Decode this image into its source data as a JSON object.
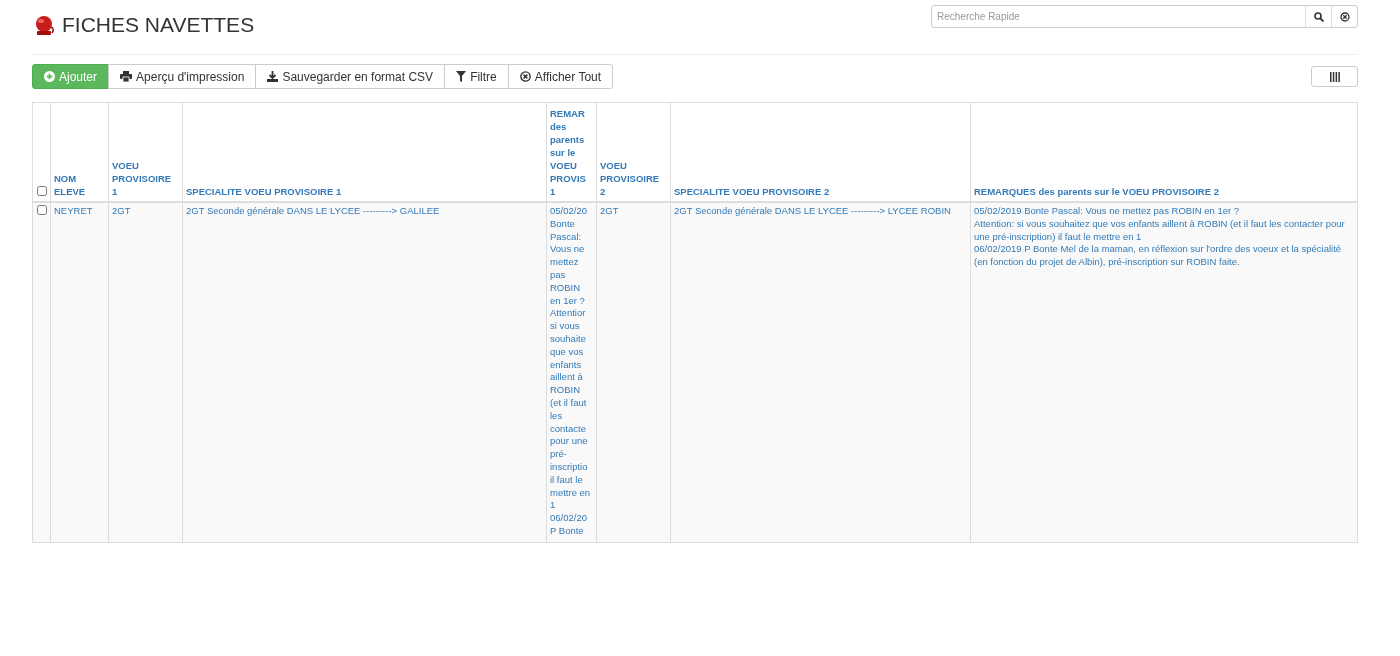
{
  "page": {
    "title": "FICHES NAVETTES"
  },
  "search": {
    "placeholder": "Recherche Rapide"
  },
  "toolbar": [
    {
      "kind": "add",
      "label": "Ajouter"
    },
    {
      "kind": "print",
      "label": "Aperçu d'impression"
    },
    {
      "kind": "download",
      "label": "Sauvegarder en format CSV"
    },
    {
      "kind": "filter",
      "label": "Filtre"
    },
    {
      "kind": "clear",
      "label": "Afficher Tout"
    }
  ],
  "table": {
    "select_all": {
      "checked": false
    },
    "columns": [
      "NOM ELEVE",
      "VOEU PROVISOIRE 1",
      "SPECIALITE VOEU PROVISOIRE 1",
      "REMAR des parents sur le VOEU PROVIS 1",
      "VOEU PROVISOIRE 2",
      "SPECIALITE VOEU PROVISOIRE 2",
      "REMARQUES des parents sur le VOEU PROVISOIRE 2"
    ],
    "rows": [
      {
        "selected": false,
        "cells": [
          "NEYRET",
          "2GT",
          "2GT Seconde générale DANS LE LYCEE ---------> GALILEE",
          "05/02/20 Bonte Pascal: Vous ne mettez pas ROBIN en 1er ? Attentior si vous souhaite que vos enfants aillent à ROBIN (et il faut les contacte pour une pré-inscriptio il faut le mettre en 1 06/02/20 P Bonte",
          "2GT",
          "2GT Seconde générale DANS LE LYCEE ---------> LYCEE ROBIN",
          "05/02/2019 Bonte Pascal: Vous ne mettez pas ROBIN en 1er ?\nAttention: si vous souhaitez que vos enfants aillent à ROBIN (et il faut les contacter pour une pré-inscription) il faut le mettre en 1\n06/02/2019 P Bonte Mel de la maman, en réflexion sur l'ordre des voeux et la spécialité (en fonction du projet de Albin), pré-inscription sur ROBIN faite."
        ]
      }
    ]
  }
}
